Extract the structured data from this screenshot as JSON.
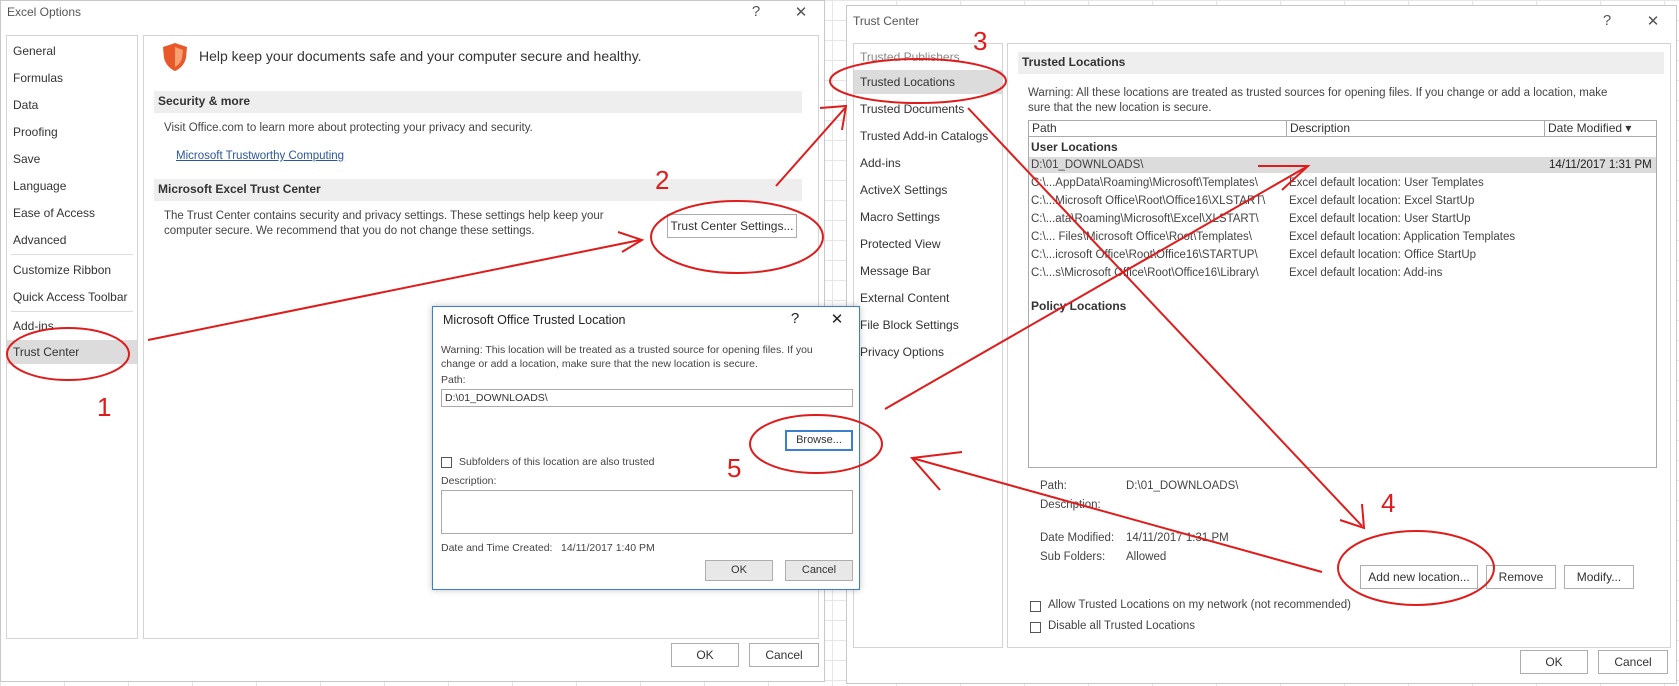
{
  "excel_options": {
    "title": "Excel Options",
    "help": "?",
    "close": "✕",
    "nav": [
      "General",
      "Formulas",
      "Data",
      "Proofing",
      "Save",
      "Language",
      "Ease of Access",
      "Advanced",
      "Customize Ribbon",
      "Quick Access Toolbar",
      "Add-ins",
      "Trust Center"
    ],
    "heading": "Help keep your documents safe and your computer secure and healthy.",
    "security_section": "Security & more",
    "security_text": "Visit Office.com to learn more about protecting your privacy and security.",
    "security_link": "Microsoft Trustworthy Computing",
    "trust_section": "Microsoft Excel Trust Center",
    "trust_text_1": "The Trust Center contains security and privacy settings. These settings help keep your",
    "trust_text_2": "computer secure. We recommend that you do not change these settings.",
    "trust_button": "Trust Center Settings...",
    "ok": "OK",
    "cancel": "Cancel"
  },
  "trust_center": {
    "title": "Trust Center",
    "help": "?",
    "close": "✕",
    "nav": [
      "Trusted Publishers",
      "Trusted Locations",
      "Trusted Documents",
      "Trusted Add-in Catalogs",
      "Add-ins",
      "ActiveX Settings",
      "Macro Settings",
      "Protected View",
      "Message Bar",
      "External Content",
      "File Block Settings",
      "Privacy Options"
    ],
    "section": "Trusted Locations",
    "warning_1": "Warning: All these locations are treated as trusted sources for opening files.  If you change or add a location, make",
    "warning_2": "sure that the new location is secure.",
    "columns": [
      "Path",
      "Description",
      "Date Modified ▾"
    ],
    "user_locations_label": "User Locations",
    "rows": [
      {
        "path": "D:\\01_DOWNLOADS\\",
        "desc": "",
        "date": "14/11/2017 1:31 PM"
      },
      {
        "path": "C:\\...AppData\\Roaming\\Microsoft\\Templates\\",
        "desc": "Excel default location: User Templates",
        "date": ""
      },
      {
        "path": "C:\\...Microsoft Office\\Root\\Office16\\XLSTART\\",
        "desc": "Excel default location: Excel StartUp",
        "date": ""
      },
      {
        "path": "C:\\...ata\\Roaming\\Microsoft\\Excel\\XLSTART\\",
        "desc": "Excel default location: User StartUp",
        "date": ""
      },
      {
        "path": "C:\\... Files\\Microsoft Office\\Root\\Templates\\",
        "desc": "Excel default location: Application Templates",
        "date": ""
      },
      {
        "path": "C:\\...icrosoft Office\\Root\\Office16\\STARTUP\\",
        "desc": "Excel default location: Office StartUp",
        "date": ""
      },
      {
        "path": "C:\\...s\\Microsoft Office\\Root\\Office16\\Library\\",
        "desc": "Excel default location: Add-ins",
        "date": ""
      }
    ],
    "policy_locations_label": "Policy Locations",
    "detail_path_label": "Path:",
    "detail_path_value": "D:\\01_DOWNLOADS\\",
    "detail_desc_label": "Description:",
    "detail_date_label": "Date Modified:",
    "detail_date_value": "14/11/2017 1:31 PM",
    "detail_sub_label": "Sub Folders:",
    "detail_sub_value": "Allowed",
    "add_button": "Add new location...",
    "remove_button": "Remove",
    "modify_button": "Modify...",
    "allow_network": "Allow Trusted Locations on my network (not recommended)",
    "disable_all": "Disable all Trusted Locations",
    "ok": "OK",
    "cancel": "Cancel"
  },
  "location_dialog": {
    "title": "Microsoft Office Trusted Location",
    "help": "?",
    "close": "✕",
    "warning_1": "Warning: This location will be treated as a trusted source for opening files. If you",
    "warning_2": "change or add a location, make sure that the new location is secure.",
    "path_label": "Path:",
    "path_value": "D:\\01_DOWNLOADS\\",
    "browse": "Browse...",
    "subfolders": "Subfolders of this location are also trusted",
    "desc_label": "Description:",
    "date_label": "Date and Time Created:",
    "date_value": "14/11/2017 1:40 PM",
    "ok": "OK",
    "cancel": "Cancel"
  },
  "annotations": {
    "n1": "1",
    "n2": "2",
    "n3": "3",
    "n4": "4",
    "n5": "5"
  },
  "colors": {
    "annotation": "#e01b1b",
    "shield": "#e8582a",
    "selected": "#dcdcdc",
    "link": "#2b579a"
  }
}
